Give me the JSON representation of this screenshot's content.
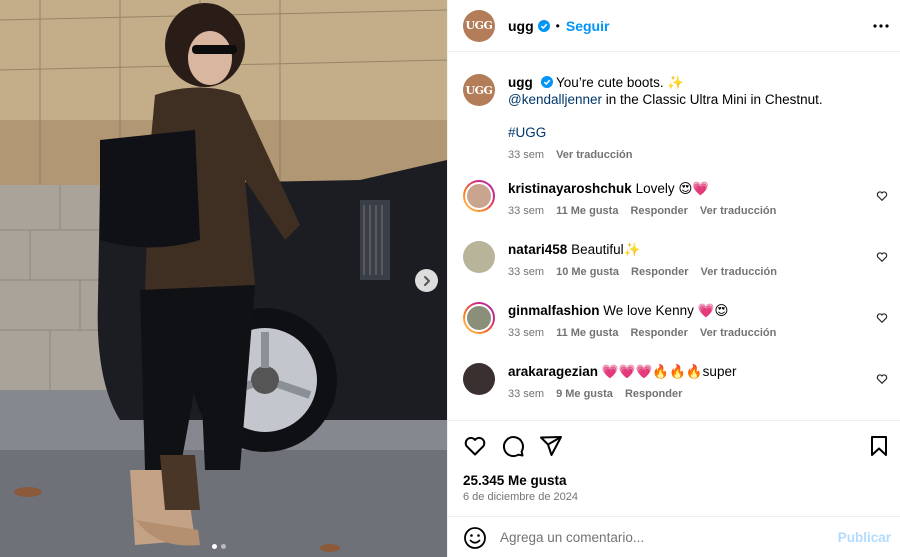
{
  "post": {
    "username": "ugg",
    "avatar_text": "UGG",
    "follow_label": "Seguir",
    "separator": "•",
    "caption_text": "You’re cute boots. ✨",
    "mention": "@kendalljenner",
    "caption_rest": " in the Classic Ultra Mini in Chestnut.",
    "hashtag": "#UGG",
    "time": "33 sem",
    "translate": "Ver traducción"
  },
  "comments": [
    {
      "username": "kristinayaroshchuk",
      "text": "Lovely 😍💗",
      "time": "33 sem",
      "likes": "11 Me gusta",
      "reply": "Responder",
      "translate": "Ver traducción",
      "avatar_color": "#c9a48f",
      "ring": true
    },
    {
      "username": "natari458",
      "text": "Beautiful✨",
      "time": "33 sem",
      "likes": "10 Me gusta",
      "reply": "Responder",
      "translate": "Ver traducción",
      "avatar_color": "#b8b49a",
      "ring": false
    },
    {
      "username": "ginmalfashion",
      "text": "We love Kenny 💗😍",
      "time": "33 sem",
      "likes": "11 Me gusta",
      "reply": "Responder",
      "translate": "Ver traducción",
      "avatar_color": "#8a8f7a",
      "ring": true
    },
    {
      "username": "arakaragezian",
      "text": "💗💗💗🔥🔥🔥super",
      "time": "33 sem",
      "likes": "9 Me gusta",
      "reply": "Responder",
      "translate": "",
      "avatar_color": "#3b3030",
      "ring": false
    }
  ],
  "footer": {
    "likes": "25.345 Me gusta",
    "date": "6 de diciembre de 2024",
    "comment_placeholder": "Agrega un comentario...",
    "publish_label": "Publicar"
  },
  "carousel": {
    "slide": 1,
    "slides": 2
  },
  "colors": {
    "accent": "#0095f6",
    "link": "#00376b",
    "muted": "#737373",
    "verified": "#0095f6",
    "brand": "#b27d58"
  },
  "icons": [
    "more-icon",
    "verified-icon",
    "heart-icon",
    "comment-icon",
    "share-icon",
    "save-icon",
    "emoji-icon",
    "chevron-right-icon"
  ]
}
